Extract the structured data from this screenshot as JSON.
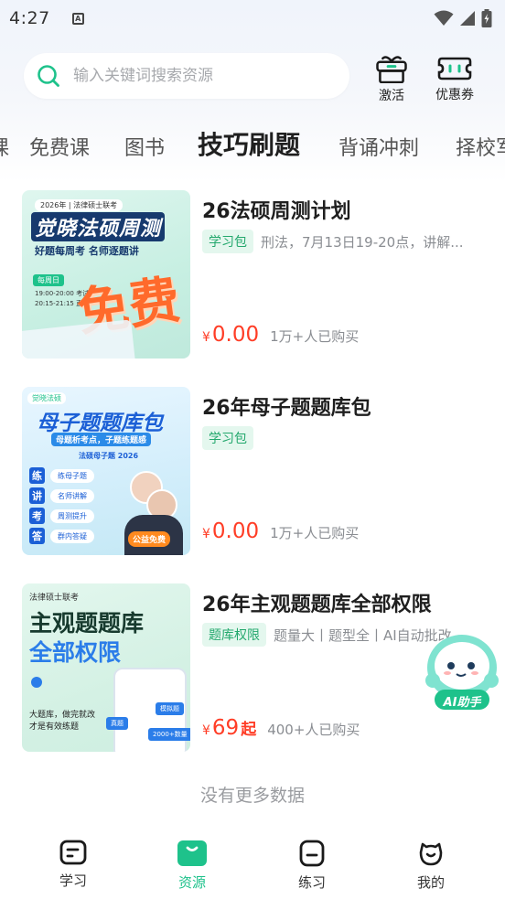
{
  "status_bar": {
    "time": "4:27",
    "notification_icon": "A"
  },
  "search": {
    "placeholder": "输入关键词搜索资源"
  },
  "header_actions": [
    {
      "label": "激活",
      "icon": "gift-box-icon"
    },
    {
      "label": "优惠券",
      "icon": "coupon-icon"
    }
  ],
  "tabs": [
    {
      "label": "课"
    },
    {
      "label": "免费课"
    },
    {
      "label": "图书"
    },
    {
      "label": "技巧刷题"
    },
    {
      "label": "背诵冲刺"
    },
    {
      "label": "择校军"
    }
  ],
  "active_tab": "技巧刷题",
  "products": [
    {
      "title": "26法硕周测计划",
      "tag": "学习包",
      "desc": "刑法，7月13日19-20点，讲解...",
      "price": "0.00",
      "yen": "¥",
      "suffix": "",
      "sold": "1万+人已购买",
      "thumb": {
        "top_tag": "2026年 | 法律硕士联考",
        "headline": "觉晓法硕周测",
        "sub": "好题每周考 名师逐题讲",
        "badge": "每周日",
        "line1": "19:00-20:00 考试",
        "line2": "20:15-21:15 直播",
        "big": "免费"
      }
    },
    {
      "title": "26年母子题题库包",
      "tag": "学习包",
      "desc": "",
      "price": "0.00",
      "yen": "¥",
      "suffix": "",
      "sold": "1万+人已购买",
      "thumb": {
        "logo": "觉晓法硕",
        "headline": "母子题题库包",
        "sub": "母题析考点，子题练题感",
        "ribbon": "法硕母子题 2026",
        "steps": [
          {
            "k": "练",
            "v": "练母子题"
          },
          {
            "k": "讲",
            "v": "名师讲解"
          },
          {
            "k": "考",
            "v": "周测提升"
          },
          {
            "k": "答",
            "v": "群内答疑"
          }
        ],
        "badge": "公益免费"
      }
    },
    {
      "title": "26年主观题题库全部权限",
      "tag": "题库权限",
      "desc": "题量大丨题型全丨AI自动批改",
      "price": "69",
      "yen": "¥",
      "suffix": "起",
      "sold": "400+人已购买",
      "thumb": {
        "top_tag": "法律硕士联考",
        "headline1": "主观题题库",
        "headline2": "全部权限",
        "sub1": "大题库，做完就改",
        "sub2": "才是有效练题",
        "chip1": "真题",
        "chip2": "模拟题",
        "chip3": "2000+数量"
      }
    }
  ],
  "no_more": "没有更多数据",
  "ai_assistant": {
    "label": "AI助手"
  },
  "bottom_nav": [
    {
      "label": "学习",
      "icon": "study-icon"
    },
    {
      "label": "资源",
      "icon": "resource-icon"
    },
    {
      "label": "练习",
      "icon": "practice-icon"
    },
    {
      "label": "我的",
      "icon": "profile-icon"
    }
  ],
  "active_nav": "资源",
  "colors": {
    "accent": "#1ec28b",
    "price": "#ff3d26",
    "tag_text": "#23a86d",
    "tag_bg": "#e4f7ee"
  }
}
